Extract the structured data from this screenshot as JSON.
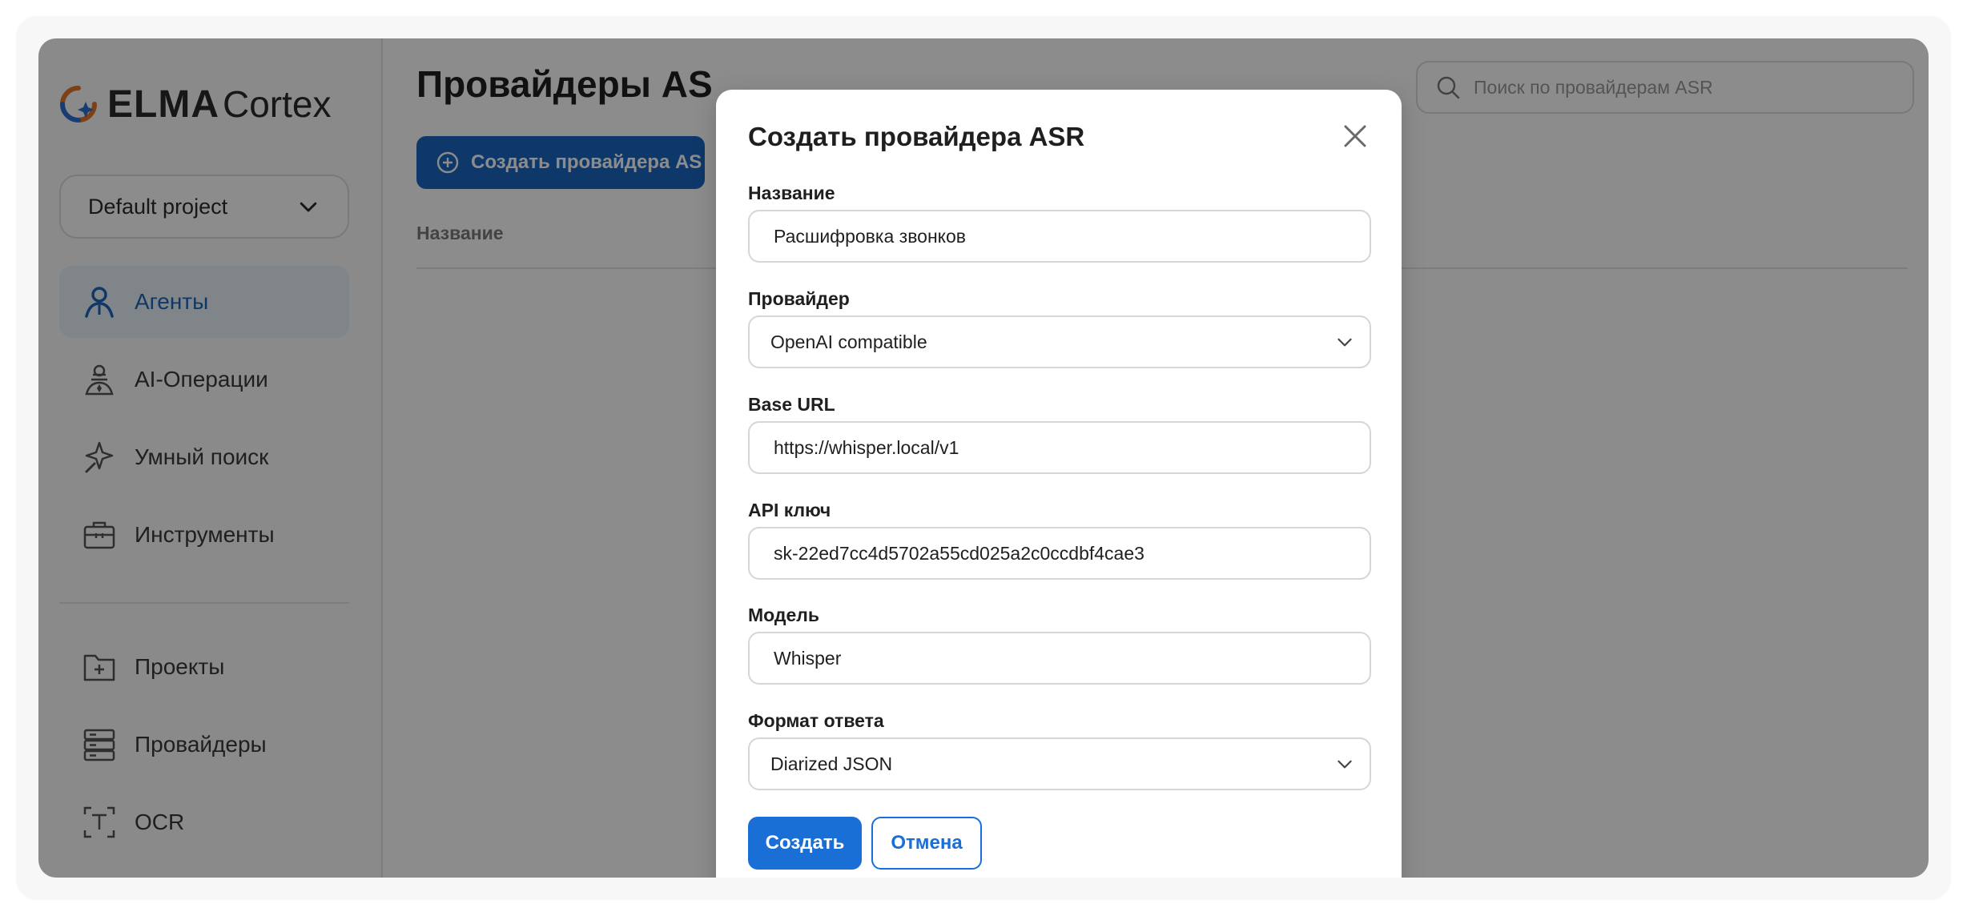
{
  "sidebar": {
    "logo": {
      "brand": "ELMA",
      "product": "Cortex"
    },
    "project": "Default project",
    "items": [
      {
        "label": "Агенты",
        "icon": "agent-icon",
        "active": true
      },
      {
        "label": "AI-Операции",
        "icon": "ai-operations-icon",
        "active": false
      },
      {
        "label": "Умный поиск",
        "icon": "smart-search-icon",
        "active": false
      },
      {
        "label": "Инструменты",
        "icon": "toolbox-icon",
        "active": false
      }
    ],
    "items2": [
      {
        "label": "Проекты",
        "icon": "folder-plus-icon"
      },
      {
        "label": "Провайдеры",
        "icon": "server-icon"
      },
      {
        "label": "OCR",
        "icon": "ocr-icon"
      }
    ]
  },
  "main": {
    "title": "Провайдеры AS",
    "create_button": "Создать провайдера AS",
    "column_header": "Название",
    "search_placeholder": "Поиск по провайдерам ASR"
  },
  "modal": {
    "title": "Создать провайдера ASR",
    "fields": {
      "name": {
        "label": "Название",
        "value": "Расшифровка звонков"
      },
      "provider": {
        "label": "Провайдер",
        "value": "OpenAI compatible"
      },
      "base_url": {
        "label": "Base URL",
        "value": "https://whisper.local/v1"
      },
      "api_key": {
        "label": "API ключ",
        "value": "sk-22ed7cc4d5702a55cd025a2c0ccdbf4cae3"
      },
      "model": {
        "label": "Модель",
        "value": "Whisper"
      },
      "format": {
        "label": "Формат ответа",
        "value": "Diarized JSON"
      }
    },
    "submit": "Создать",
    "cancel": "Отмена"
  },
  "colors": {
    "accent": "#1a6fd6",
    "active_nav_bg": "#e9f2fb",
    "active_nav_text": "#1f66b8",
    "overlay": "rgba(0,0,0,0.45)"
  }
}
